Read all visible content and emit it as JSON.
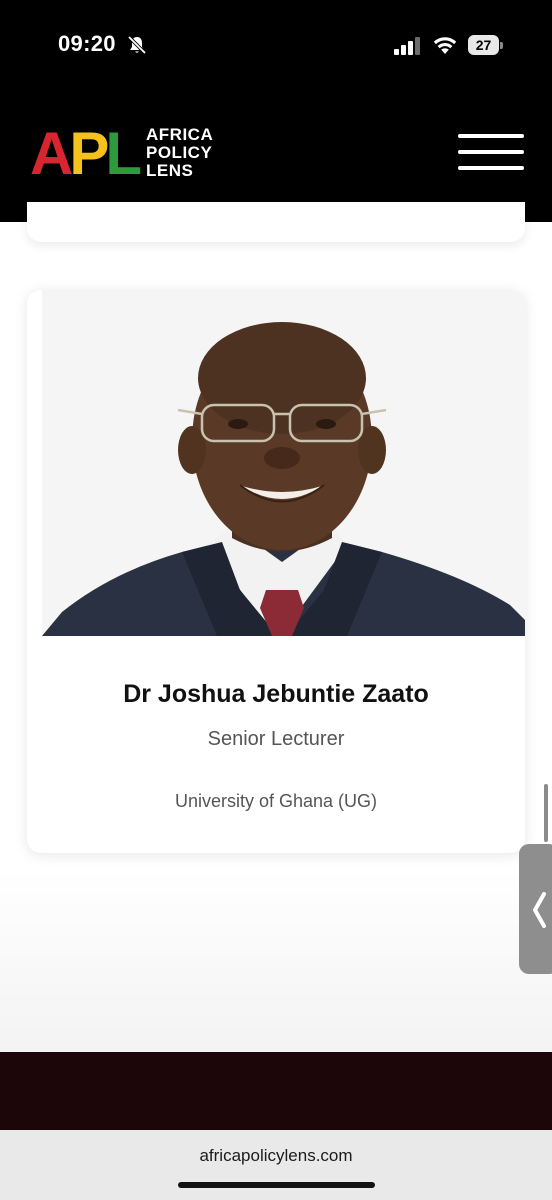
{
  "status_bar": {
    "time": "09:20",
    "battery_level": "27",
    "icons": [
      "bell-off-icon",
      "signal-icon",
      "wifi-icon",
      "battery-icon"
    ]
  },
  "header": {
    "logo_mark": {
      "a": "A",
      "p": "P",
      "l": "L"
    },
    "logo_text": [
      "AFRICA",
      "POLICY",
      "LENS"
    ],
    "menu_icon": "hamburger-menu-icon"
  },
  "profile": {
    "name": "Dr Joshua Jebuntie Zaato",
    "role": "Senior Lecturer",
    "organization": "University of Ghana (UG)"
  },
  "side_tab_icon": "chevron-left-icon",
  "browser": {
    "url": "africapolicylens.com"
  },
  "colors": {
    "header_bg": "#000000",
    "logo_red": "#d7262f",
    "logo_yellow": "#f4c21b",
    "logo_green": "#2e9a3e",
    "footer_bg": "#1d060a",
    "address_bar_bg": "#e9e9e9"
  }
}
